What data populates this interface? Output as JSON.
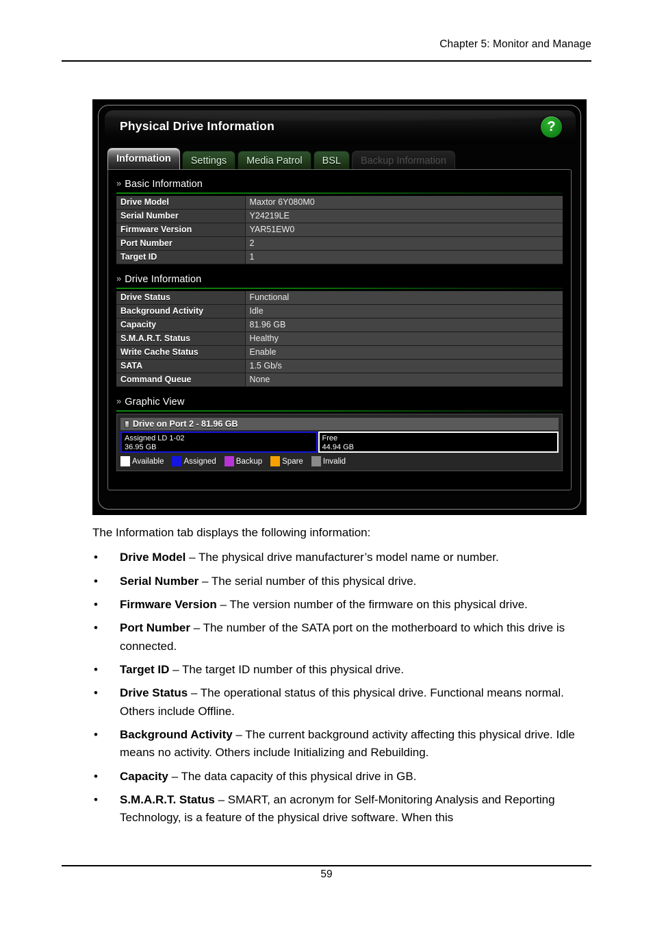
{
  "document": {
    "running_header": "Chapter 5: Monitor and Manage",
    "page_number": "59"
  },
  "window": {
    "title": "Physical Drive Information",
    "help_icon_label": "?",
    "tabs": [
      {
        "label": "Information",
        "state": "active"
      },
      {
        "label": "Settings",
        "state": "enabled"
      },
      {
        "label": "Media Patrol",
        "state": "enabled"
      },
      {
        "label": "BSL",
        "state": "enabled"
      },
      {
        "label": "Backup Information",
        "state": "disabled"
      }
    ],
    "sections": {
      "basic_information": {
        "title": "Basic Information",
        "rows": [
          {
            "label": "Drive Model",
            "value": "Maxtor 6Y080M0"
          },
          {
            "label": "Serial Number",
            "value": "Y24219LE"
          },
          {
            "label": "Firmware Version",
            "value": "YAR51EW0"
          },
          {
            "label": "Port Number",
            "value": "2"
          },
          {
            "label": "Target ID",
            "value": "1"
          }
        ]
      },
      "drive_information": {
        "title": "Drive Information",
        "rows": [
          {
            "label": "Drive Status",
            "value": "Functional"
          },
          {
            "label": "Background Activity",
            "value": "Idle"
          },
          {
            "label": "Capacity",
            "value": "81.96 GB"
          },
          {
            "label": "S.M.A.R.T. Status",
            "value": "Healthy"
          },
          {
            "label": "Write Cache Status",
            "value": "Enable"
          },
          {
            "label": "SATA",
            "value": "1.5 Gb/s"
          },
          {
            "label": "Command Queue",
            "value": "None"
          }
        ]
      },
      "graphic_view": {
        "title": "Graphic View",
        "drive_header": "Drive on Port 2 - 81.96 GB",
        "segments": [
          {
            "name": "Assigned LD 1-02",
            "size": "36.95 GB",
            "percent": 45,
            "border_color": "#1515e0"
          },
          {
            "name": "Free",
            "size": "44.94 GB",
            "percent": 55,
            "border_color": "#ffffff"
          }
        ],
        "legend": [
          {
            "label": "Available",
            "color": "#ffffff"
          },
          {
            "label": "Assigned",
            "color": "#1515e0"
          },
          {
            "label": "Backup",
            "color": "#b934d6"
          },
          {
            "label": "Spare",
            "color": "#f5a202"
          },
          {
            "label": "Invalid",
            "color": "#8a8a8a"
          }
        ]
      }
    }
  },
  "prose": {
    "intro": "The Information tab displays the following information:",
    "bullet_char": "•",
    "items": [
      {
        "term": "Drive Model",
        "desc": " – The physical drive manufacturer’s model name or number."
      },
      {
        "term": "Serial Number",
        "desc": " – The serial number of this physical drive."
      },
      {
        "term": "Firmware Version",
        "desc": " – The version number of the firmware on this physical drive."
      },
      {
        "term": "Port Number",
        "desc": " – The number of the SATA port on the motherboard to which this drive is connected."
      },
      {
        "term": "Target ID",
        "desc": " – The target ID number of this physical drive."
      },
      {
        "term": "Drive Status",
        "desc": " – The operational status of this physical drive. Functional means normal. Others include Offline."
      },
      {
        "term": "Background Activity",
        "desc": " – The current background activity affecting this physical drive. Idle means no activity. Others include Initializing and Rebuilding."
      },
      {
        "term": "Capacity",
        "desc": " – The data capacity of this physical drive in GB."
      },
      {
        "term": "S.M.A.R.T. Status",
        "desc": " – SMART, an acronym for Self-Monitoring Analysis and Reporting Technology, is a feature of the physical drive software. When this"
      }
    ]
  }
}
